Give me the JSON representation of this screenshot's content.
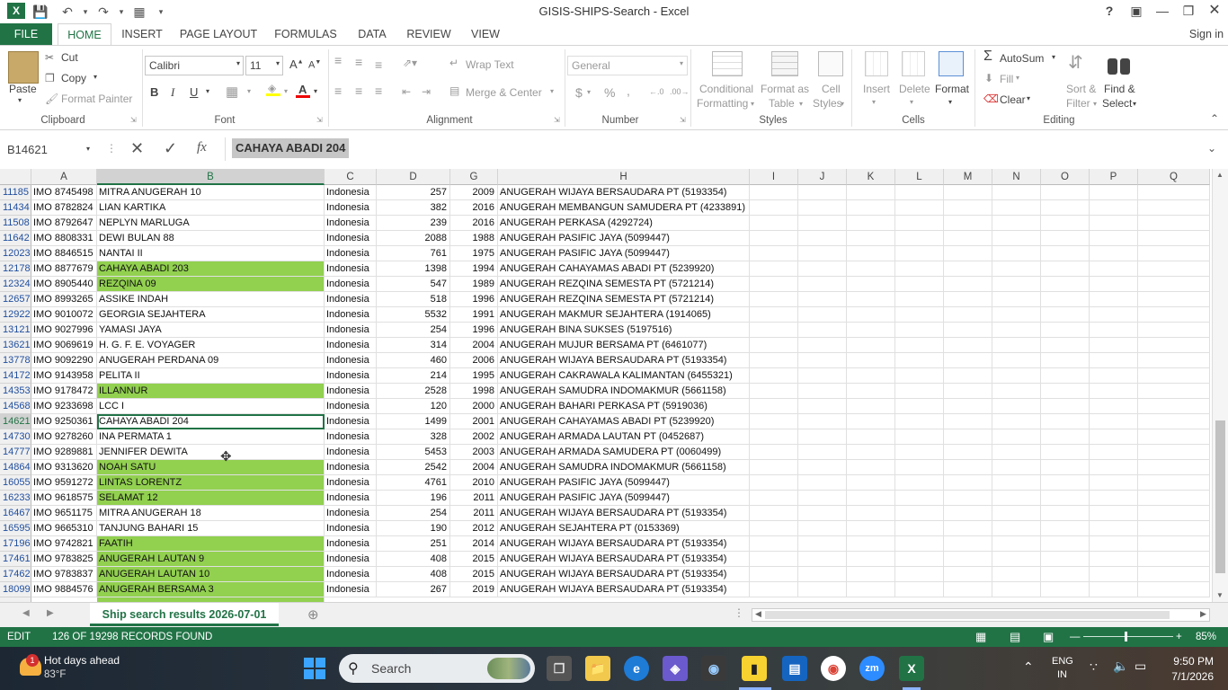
{
  "window": {
    "title": "GISIS-SHIPS-Search - Excel",
    "signin": "Sign in",
    "help": "?"
  },
  "tabs": [
    "FILE",
    "HOME",
    "INSERT",
    "PAGE LAYOUT",
    "FORMULAS",
    "DATA",
    "REVIEW",
    "VIEW"
  ],
  "ribbon": {
    "clipboard": {
      "paste": "Paste",
      "cut": "Cut",
      "copy": "Copy",
      "format_painter": "Format Painter",
      "label": "Clipboard"
    },
    "font": {
      "name": "Calibri",
      "size": "11",
      "bold": "B",
      "italic": "I",
      "underline": "U",
      "label": "Font"
    },
    "alignment": {
      "wrap": "Wrap Text",
      "merge": "Merge & Center",
      "label": "Alignment"
    },
    "number": {
      "format": "General",
      "currency": "$",
      "percent": "%",
      "comma": ",",
      "label": "Number"
    },
    "styles": {
      "conditional": "Conditional",
      "conditional2": "Formatting",
      "format_table": "Format as",
      "format_table2": "Table",
      "cell_styles": "Cell",
      "cell_styles2": "Styles",
      "label": "Styles"
    },
    "cells": {
      "insert": "Insert",
      "delete": "Delete",
      "format": "Format",
      "label": "Cells"
    },
    "editing": {
      "autosum": "AutoSum",
      "fill": "Fill",
      "clear": "Clear",
      "sort": "Sort &",
      "sort2": "Filter",
      "find": "Find &",
      "find2": "Select",
      "label": "Editing"
    }
  },
  "formula_bar": {
    "name_box": "B14621",
    "value": "CAHAYA ABADI 204",
    "fx": "fx"
  },
  "columns": [
    "A",
    "B",
    "C",
    "D",
    "G",
    "H",
    "I",
    "J",
    "K",
    "L",
    "M",
    "N",
    "O",
    "P",
    "Q"
  ],
  "rows": [
    {
      "n": "11185",
      "a": "IMO 8745498",
      "b": "MITRA ANUGERAH 10",
      "c": "Indonesia",
      "d": "257",
      "g": "2009",
      "h": "ANUGERAH WIJAYA BERSAUDARA PT (5193354)",
      "hl": false
    },
    {
      "n": "11434",
      "a": "IMO 8782824",
      "b": "LIAN KARTIKA",
      "c": "Indonesia",
      "d": "382",
      "g": "2016",
      "h": "ANUGERAH MEMBANGUN SAMUDERA PT (4233891)",
      "hl": false
    },
    {
      "n": "11508",
      "a": "IMO 8792647",
      "b": "NEPLYN MARLUGA",
      "c": "Indonesia",
      "d": "239",
      "g": "2016",
      "h": "ANUGERAH PERKASA (4292724)",
      "hl": false
    },
    {
      "n": "11642",
      "a": "IMO 8808331",
      "b": "DEWI BULAN 88",
      "c": "Indonesia",
      "d": "2088",
      "g": "1988",
      "h": "ANUGERAH PASIFIC JAYA (5099447)",
      "hl": false
    },
    {
      "n": "12023",
      "a": "IMO 8846515",
      "b": "NANTAI II",
      "c": "Indonesia",
      "d": "761",
      "g": "1975",
      "h": "ANUGERAH PASIFIC JAYA (5099447)",
      "hl": false
    },
    {
      "n": "12178",
      "a": "IMO 8877679",
      "b": "CAHAYA ABADI 203",
      "c": "Indonesia",
      "d": "1398",
      "g": "1994",
      "h": "ANUGERAH CAHAYAMAS ABADI PT (5239920)",
      "hl": true
    },
    {
      "n": "12324",
      "a": "IMO 8905440",
      "b": "REZQINA 09",
      "c": "Indonesia",
      "d": "547",
      "g": "1989",
      "h": "ANUGERAH REZQINA SEMESTA PT (5721214)",
      "hl": true
    },
    {
      "n": "12657",
      "a": "IMO 8993265",
      "b": "ASSIKE INDAH",
      "c": "Indonesia",
      "d": "518",
      "g": "1996",
      "h": "ANUGERAH REZQINA SEMESTA PT (5721214)",
      "hl": false
    },
    {
      "n": "12922",
      "a": "IMO 9010072",
      "b": "GEORGIA SEJAHTERA",
      "c": "Indonesia",
      "d": "5532",
      "g": "1991",
      "h": "ANUGERAH MAKMUR SEJAHTERA (1914065)",
      "hl": false
    },
    {
      "n": "13121",
      "a": "IMO 9027996",
      "b": "YAMASI JAYA",
      "c": "Indonesia",
      "d": "254",
      "g": "1996",
      "h": "ANUGERAH BINA SUKSES (5197516)",
      "hl": false
    },
    {
      "n": "13621",
      "a": "IMO 9069619",
      "b": "H. G. F. E. VOYAGER",
      "c": "Indonesia",
      "d": "314",
      "g": "2004",
      "h": "ANUGERAH MUJUR BERSAMA PT (6461077)",
      "hl": false
    },
    {
      "n": "13778",
      "a": "IMO 9092290",
      "b": "ANUGERAH PERDANA 09",
      "c": "Indonesia",
      "d": "460",
      "g": "2006",
      "h": "ANUGERAH WIJAYA BERSAUDARA PT (5193354)",
      "hl": false
    },
    {
      "n": "14172",
      "a": "IMO 9143958",
      "b": "PELITA II",
      "c": "Indonesia",
      "d": "214",
      "g": "1995",
      "h": "ANUGERAH CAKRAWALA KALIMANTAN (6455321)",
      "hl": false
    },
    {
      "n": "14353",
      "a": "IMO 9178472",
      "b": "ILLANNUR",
      "c": "Indonesia",
      "d": "2528",
      "g": "1998",
      "h": "ANUGERAH SAMUDRA INDOMAKMUR (5661158)",
      "hl": true
    },
    {
      "n": "14568",
      "a": "IMO 9233698",
      "b": "LCC I",
      "c": "Indonesia",
      "d": "120",
      "g": "2000",
      "h": "ANUGERAH BAHARI PERKASA PT (5919036)",
      "hl": false
    },
    {
      "n": "14621",
      "a": "IMO 9250361",
      "b": "CAHAYA ABADI 204",
      "c": "Indonesia",
      "d": "1499",
      "g": "2001",
      "h": "ANUGERAH CAHAYAMAS ABADI PT (5239920)",
      "hl": false,
      "active": true
    },
    {
      "n": "14730",
      "a": "IMO 9278260",
      "b": "INA PERMATA 1",
      "c": "Indonesia",
      "d": "328",
      "g": "2002",
      "h": "ANUGERAH ARMADA LAUTAN PT (0452687)",
      "hl": false
    },
    {
      "n": "14777",
      "a": "IMO 9289881",
      "b": "JENNIFER DEWITA",
      "c": "Indonesia",
      "d": "5453",
      "g": "2003",
      "h": "ANUGERAH ARMADA SAMUDERA PT (0060499)",
      "hl": false
    },
    {
      "n": "14864",
      "a": "IMO 9313620",
      "b": "NOAH SATU",
      "c": "Indonesia",
      "d": "2542",
      "g": "2004",
      "h": "ANUGERAH SAMUDRA INDOMAKMUR (5661158)",
      "hl": true
    },
    {
      "n": "16055",
      "a": "IMO 9591272",
      "b": "LINTAS LORENTZ",
      "c": "Indonesia",
      "d": "4761",
      "g": "2010",
      "h": "ANUGERAH PASIFIC JAYA (5099447)",
      "hl": true
    },
    {
      "n": "16233",
      "a": "IMO 9618575",
      "b": "SELAMAT 12",
      "c": "Indonesia",
      "d": "196",
      "g": "2011",
      "h": "ANUGERAH PASIFIC JAYA (5099447)",
      "hl": true
    },
    {
      "n": "16467",
      "a": "IMO 9651175",
      "b": "MITRA ANUGERAH 18",
      "c": "Indonesia",
      "d": "254",
      "g": "2011",
      "h": "ANUGERAH WIJAYA BERSAUDARA PT (5193354)",
      "hl": false
    },
    {
      "n": "16595",
      "a": "IMO 9665310",
      "b": "TANJUNG BAHARI 15",
      "c": "Indonesia",
      "d": "190",
      "g": "2012",
      "h": "ANUGERAH SEJAHTERA PT (0153369)",
      "hl": false
    },
    {
      "n": "17196",
      "a": "IMO 9742821",
      "b": "FAATIH",
      "c": "Indonesia",
      "d": "251",
      "g": "2014",
      "h": "ANUGERAH WIJAYA BERSAUDARA PT (5193354)",
      "hl": true
    },
    {
      "n": "17461",
      "a": "IMO 9783825",
      "b": "ANUGERAH LAUTAN 9",
      "c": "Indonesia",
      "d": "408",
      "g": "2015",
      "h": "ANUGERAH WIJAYA BERSAUDARA PT (5193354)",
      "hl": true
    },
    {
      "n": "17462",
      "a": "IMO 9783837",
      "b": "ANUGERAH LAUTAN 10",
      "c": "Indonesia",
      "d": "408",
      "g": "2015",
      "h": "ANUGERAH WIJAYA BERSAUDARA PT (5193354)",
      "hl": true
    },
    {
      "n": "18099",
      "a": "IMO 9884576",
      "b": "ANUGERAH BERSAMA 3",
      "c": "Indonesia",
      "d": "267",
      "g": "2019",
      "h": "ANUGERAH WIJAYA BERSAUDARA PT (5193354)",
      "hl": true
    }
  ],
  "sheet_tab": "Ship search results 2026-07-01",
  "status": {
    "mode": "EDIT",
    "records": "126 OF 19298 RECORDS FOUND",
    "zoom": "85%"
  },
  "taskbar": {
    "weather_title": "Hot days ahead",
    "weather_temp": "83°F",
    "weather_badge": "1",
    "search": "Search",
    "lang": "ENG",
    "lang2": "IN",
    "time": "9:50 PM",
    "date": "7/1/2026"
  },
  "colors": {
    "excel_green": "#217346",
    "highlight": "#92d050"
  }
}
